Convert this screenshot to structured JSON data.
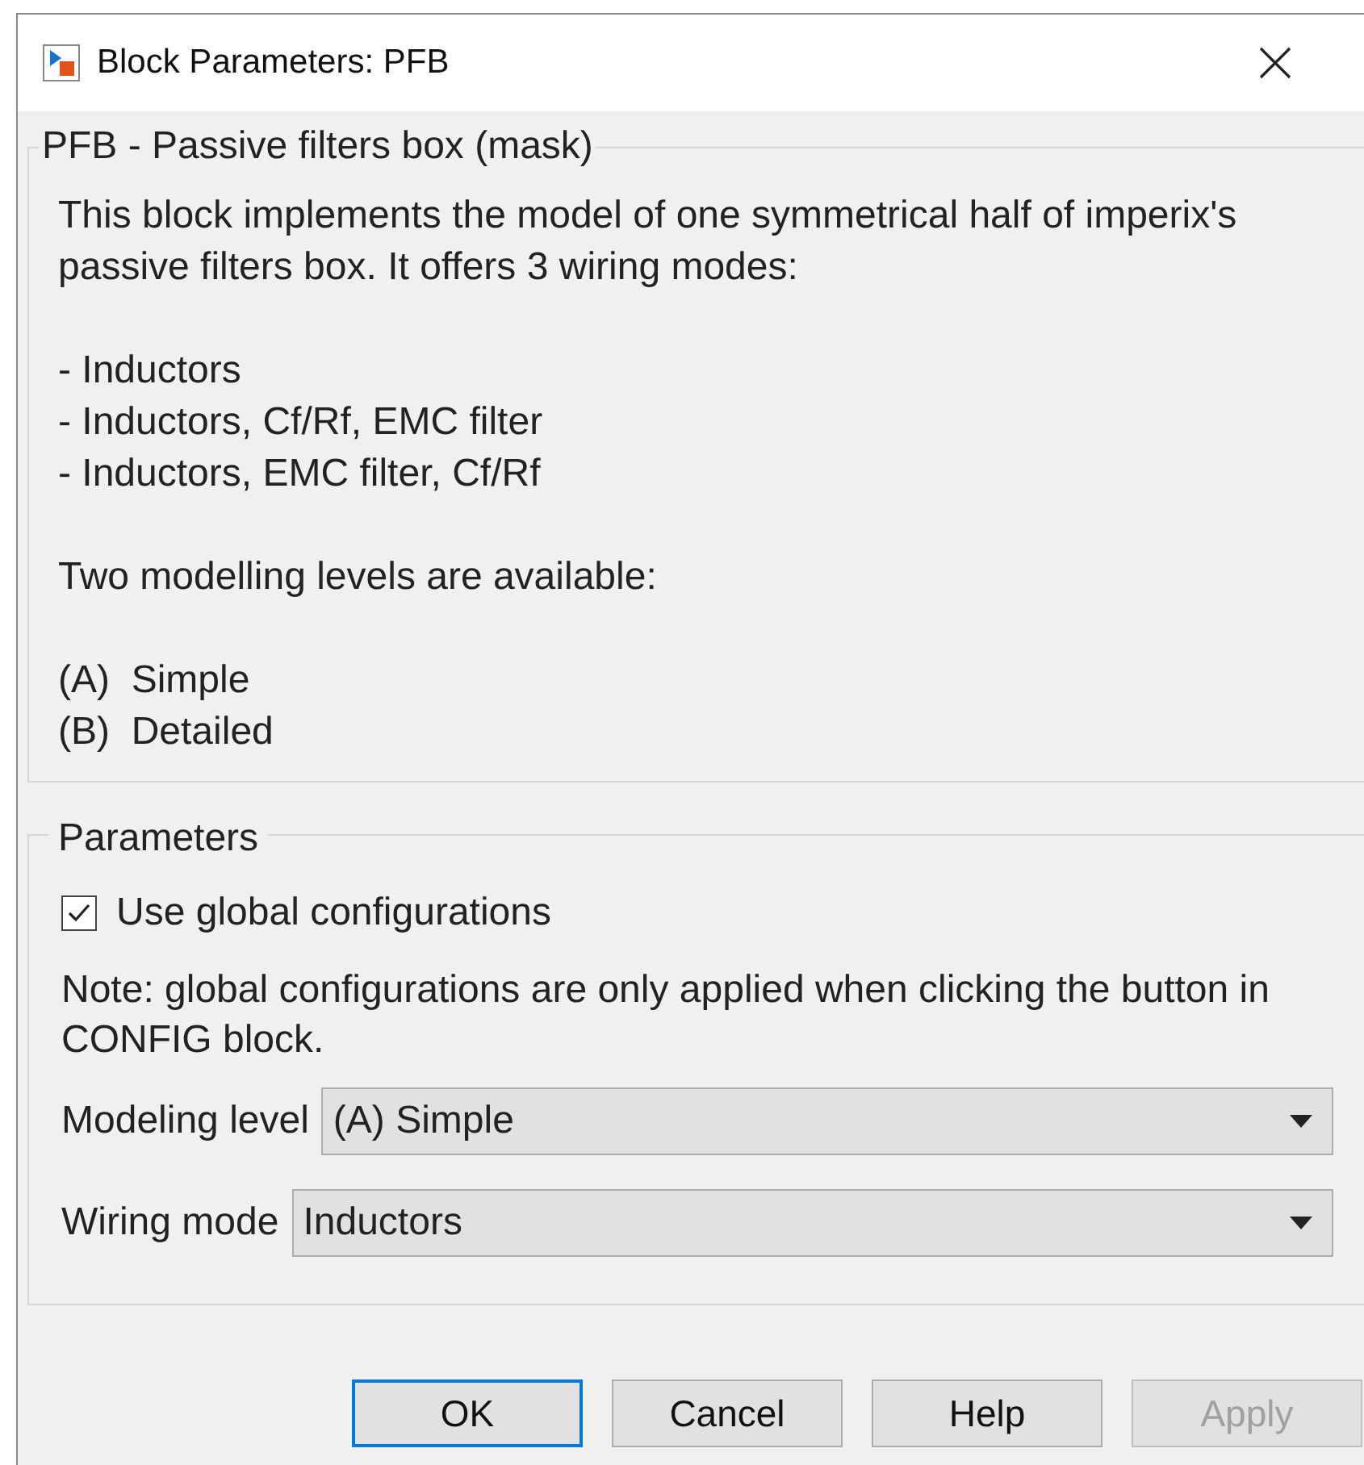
{
  "window": {
    "title": "Block Parameters: PFB"
  },
  "mask": {
    "title": "PFB - Passive filters box (mask)",
    "description": "This block implements the model of one symmetrical half of imperix's passive filters box. It offers 3 wiring modes:",
    "wiring_modes": [
      "- Inductors",
      "- Inductors, Cf/Rf, EMC filter",
      "- Inductors, EMC filter, Cf/Rf"
    ],
    "levels_intro": "Two modelling levels are available:",
    "levels": [
      "(A)  Simple",
      "(B)  Detailed"
    ]
  },
  "parameters": {
    "title": "Parameters",
    "use_global": {
      "label": "Use global configurations",
      "checked": true
    },
    "note": "Note: global configurations are only applied when clicking the button in CONFIG block.",
    "dropdowns": [
      {
        "label": "Modeling level",
        "value": "(A) Simple"
      },
      {
        "label": "Wiring mode",
        "value": "Inductors"
      }
    ]
  },
  "buttons": [
    {
      "label": "OK",
      "focused": true,
      "disabled": false
    },
    {
      "label": "Cancel",
      "focused": false,
      "disabled": false
    },
    {
      "label": "Help",
      "focused": false,
      "disabled": false
    },
    {
      "label": "Apply",
      "focused": false,
      "disabled": true
    }
  ]
}
